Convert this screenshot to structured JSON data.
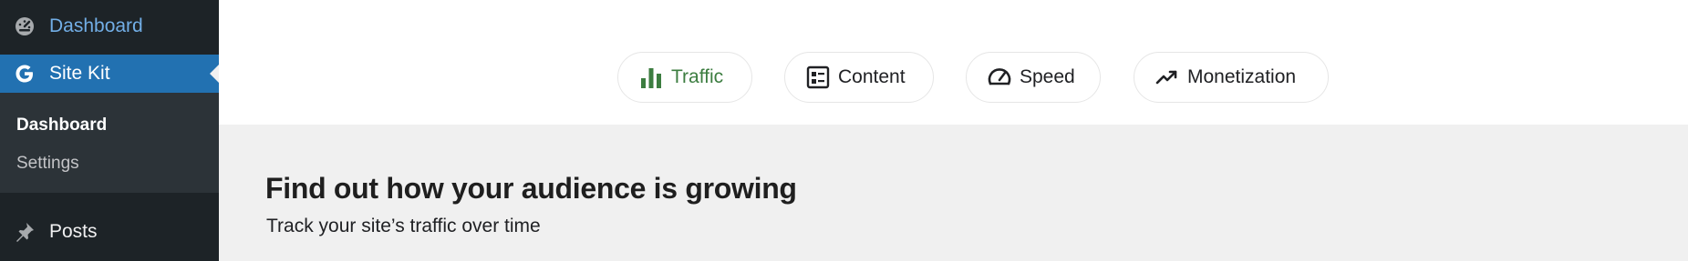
{
  "sidebar": {
    "dashboard_label": "Dashboard",
    "sitekit_label": "Site Kit",
    "submenu": {
      "dashboard": "Dashboard",
      "settings": "Settings"
    },
    "posts_label": "Posts"
  },
  "tabs": {
    "traffic": "Traffic",
    "content": "Content",
    "speed": "Speed",
    "monetization": "Monetization"
  },
  "main": {
    "heading": "Find out how your audience is growing",
    "subheading": "Track your site’s traffic over time"
  },
  "colors": {
    "sidebar_bg": "#1d2327",
    "sidebar_active": "#2271b1",
    "link_blue": "#72aee6",
    "traffic_green": "#3c7d40"
  }
}
